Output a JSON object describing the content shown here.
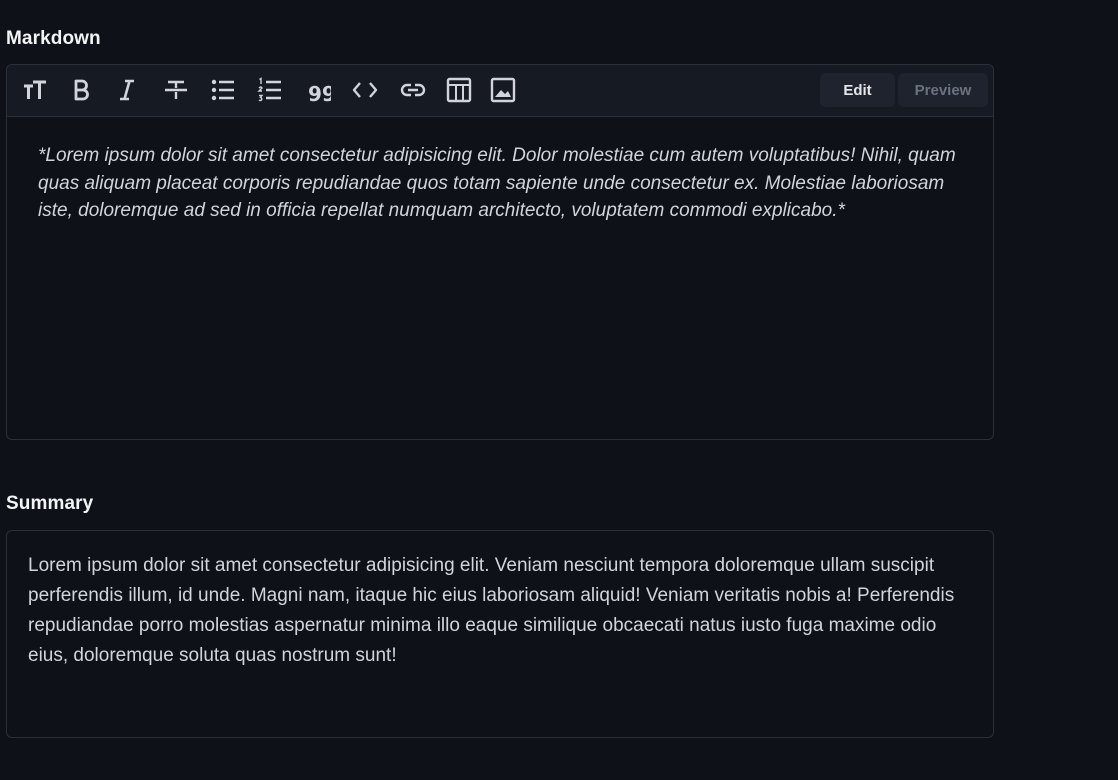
{
  "markdown": {
    "label": "Markdown",
    "toolbar": {
      "tools": [
        {
          "icon": "text-size-icon"
        },
        {
          "icon": "bold-icon",
          "glyph": "B"
        },
        {
          "icon": "italic-icon",
          "glyph": "I"
        },
        {
          "icon": "strikethrough-icon"
        },
        {
          "icon": "bullet-list-icon"
        },
        {
          "icon": "numbered-list-icon"
        },
        {
          "icon": "quote-icon",
          "glyph": "99"
        },
        {
          "icon": "code-icon"
        },
        {
          "icon": "link-icon"
        },
        {
          "icon": "table-icon"
        },
        {
          "icon": "image-icon"
        }
      ],
      "edit_label": "Edit",
      "preview_label": "Preview",
      "active_mode": "Edit"
    },
    "content": "*Lorem ipsum dolor sit amet consectetur adipisicing elit. Dolor molestiae cum autem voluptatibus! Nihil, quam quas aliquam placeat corporis repudiandae quos totam sapiente unde consectetur ex. Molestiae laboriosam iste, doloremque ad sed in officia repellat numquam architecto, voluptatem commodi explicabo.*"
  },
  "summary": {
    "label": "Summary",
    "content": "Lorem ipsum dolor sit amet consectetur adipisicing elit. Veniam nesciunt tempora doloremque ullam suscipit perferendis illum, id unde. Magni nam, itaque hic eius laboriosam aliquid! Veniam veritatis nobis a! Perferendis repudiandae porro molestias aspernatur minima illo eaque similique obcaecati natus iusto fuga maxime odio eius, doloremque soluta quas nostrum sunt!"
  },
  "colors": {
    "background": "#0e1118",
    "toolbar": "#161a23",
    "border": "#2a2f3a",
    "icon": "#d1d5db",
    "text": "#d1d5db"
  }
}
